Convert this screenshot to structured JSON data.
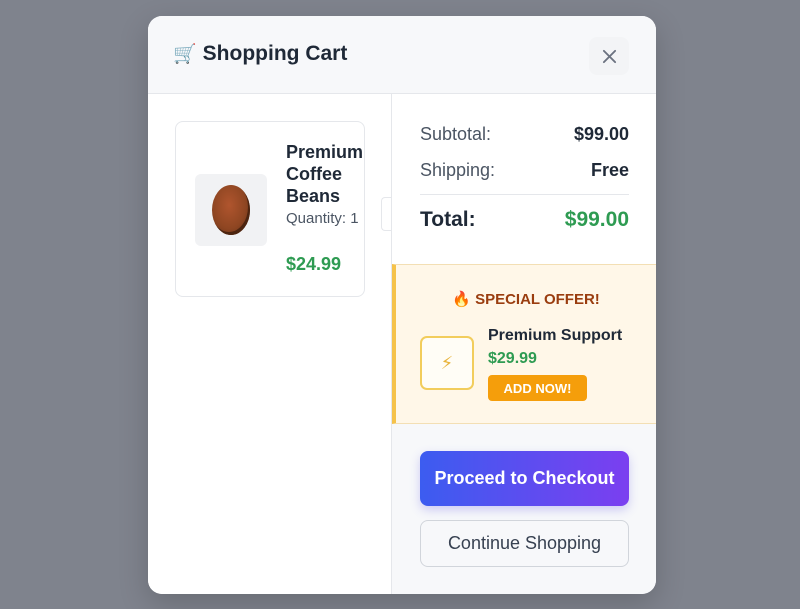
{
  "modal": {
    "title": "Shopping Cart",
    "cart_icon": "🛒",
    "close_icon": "close-icon"
  },
  "cart": {
    "items": [
      {
        "name": "Premium Coffee Beans",
        "quantity_label": "Quantity: 1",
        "price": "$24.99",
        "icon": "coffee-bean-icon"
      }
    ]
  },
  "summary": {
    "subtotal_label": "Subtotal:",
    "subtotal_value": "$99.00",
    "shipping_label": "Shipping:",
    "shipping_value": "Free",
    "total_label": "Total:",
    "total_value": "$99.00"
  },
  "offer": {
    "fire_icon": "🔥",
    "title": "SPECIAL OFFER!",
    "product_icon": "⚡",
    "product_name": "Premium Support",
    "product_price": "$29.99",
    "add_label": "ADD NOW!"
  },
  "actions": {
    "checkout_label": "Proceed to Checkout",
    "continue_label": "Continue Shopping"
  },
  "colors": {
    "accent_green": "#2e9b52",
    "offer_orange": "#f59e0b",
    "checkout_gradient_start": "#3c5cf0",
    "checkout_gradient_end": "#7b3ff0"
  }
}
